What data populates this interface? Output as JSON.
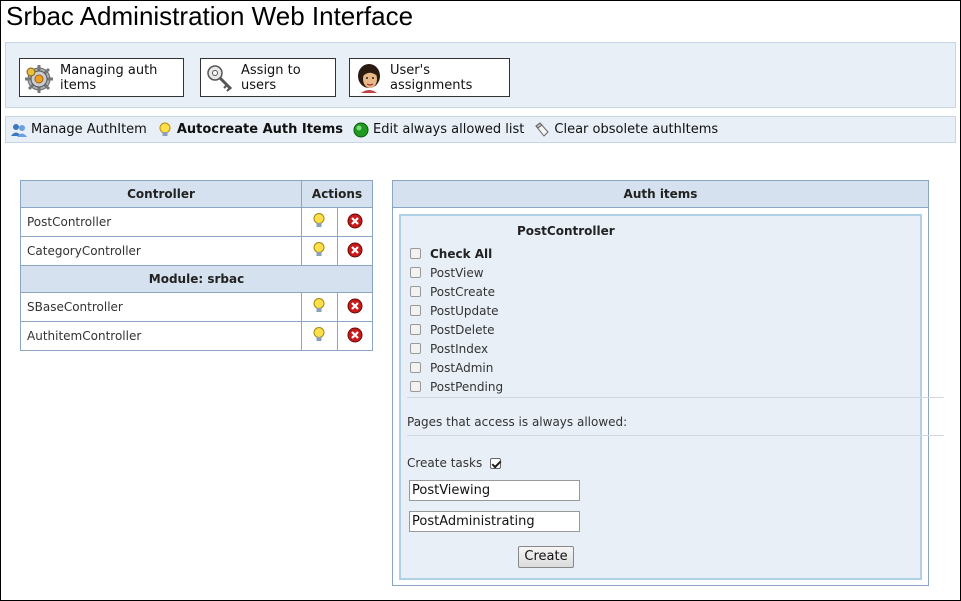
{
  "page": {
    "title": "Srbac Administration Web Interface"
  },
  "main_menu": [
    {
      "label": "Managing auth items",
      "icon": "gears-icon"
    },
    {
      "label": "Assign to users",
      "icon": "keys-icon"
    },
    {
      "label": "User's assignments",
      "icon": "user-avatar-icon"
    }
  ],
  "sub_menu": [
    {
      "label": "Manage AuthItem",
      "icon": "users-icon"
    },
    {
      "label": "Autocreate Auth Items",
      "icon": "lightbulb-icon"
    },
    {
      "label": "Edit always allowed list",
      "icon": "green-dot-icon"
    },
    {
      "label": "Clear obsolete authItems",
      "icon": "eraser-icon"
    }
  ],
  "controllers_table": {
    "headers": [
      "Controller",
      "Actions"
    ],
    "rows": [
      "PostController",
      "CategoryController"
    ],
    "module_label": "Module: srbac",
    "module_rows": [
      "SBaseController",
      "AuthitemController"
    ]
  },
  "auth_panel": {
    "header": "Auth items",
    "controller_title": "PostController",
    "check_all_label": "Check All",
    "actions": [
      "PostView",
      "PostCreate",
      "PostUpdate",
      "PostDelete",
      "PostIndex",
      "PostAdmin",
      "PostPending"
    ],
    "allowed_label": "Pages that access is always allowed:",
    "create_tasks_label": "Create tasks",
    "create_tasks_checked": true,
    "task_inputs": [
      "PostViewing",
      "PostAdministrating"
    ],
    "create_button": "Create"
  }
}
